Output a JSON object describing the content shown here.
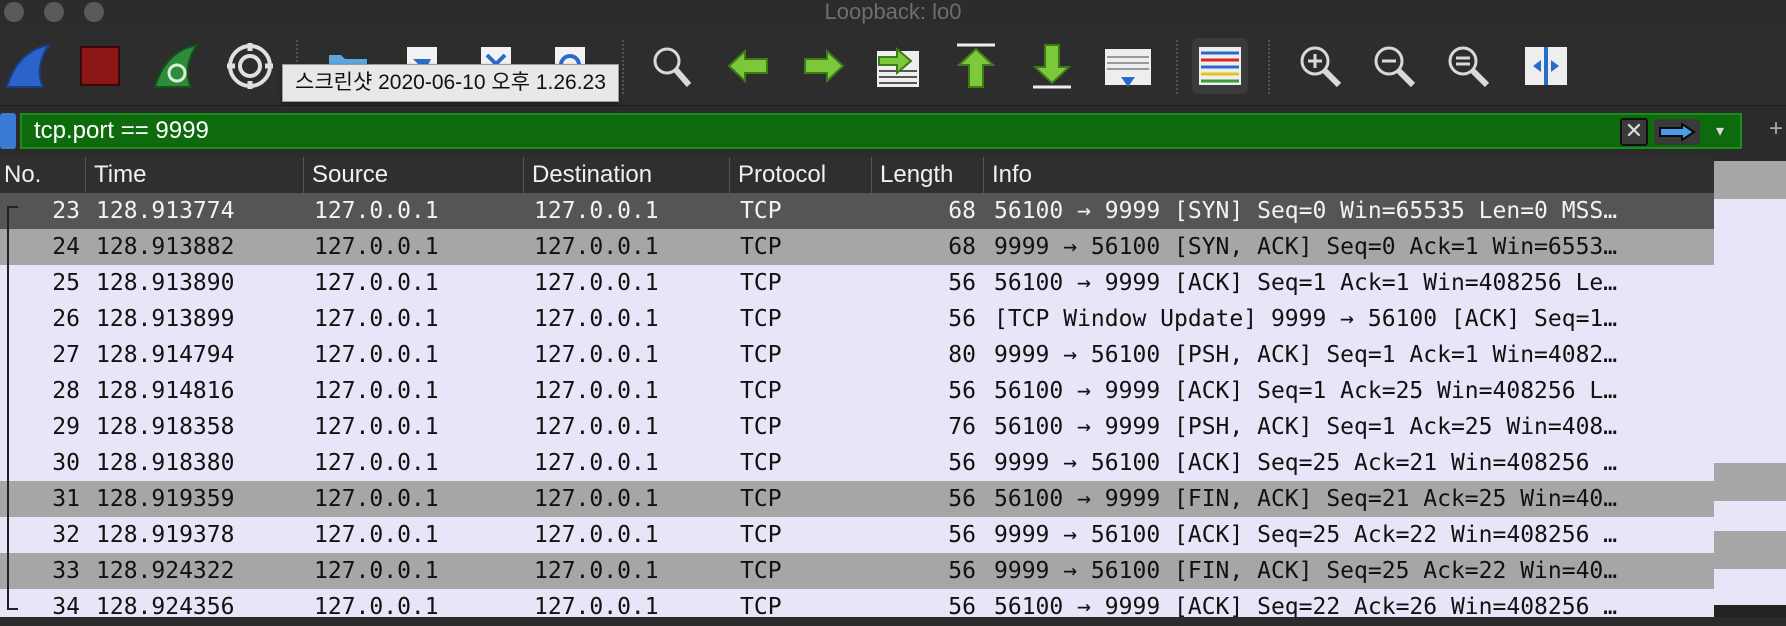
{
  "window": {
    "title": "Loopback: lo0"
  },
  "toolbar": {
    "buttons": [
      {
        "name": "start-capture-icon"
      },
      {
        "name": "stop-capture-icon"
      },
      {
        "name": "restart-capture-icon"
      },
      {
        "name": "capture-options-icon"
      },
      {
        "name": "open-file-icon"
      },
      {
        "name": "save-file-icon"
      },
      {
        "name": "close-file-icon"
      },
      {
        "name": "reload-file-icon"
      },
      {
        "name": "find-packet-icon"
      },
      {
        "name": "go-back-icon"
      },
      {
        "name": "go-forward-icon"
      },
      {
        "name": "go-to-packet-icon"
      },
      {
        "name": "go-to-first-packet-icon"
      },
      {
        "name": "go-to-last-packet-icon"
      },
      {
        "name": "auto-scroll-icon"
      },
      {
        "name": "colorize-icon"
      },
      {
        "name": "zoom-in-icon"
      },
      {
        "name": "zoom-out-icon"
      },
      {
        "name": "normal-size-icon"
      },
      {
        "name": "resize-columns-icon"
      }
    ],
    "tooltip": "스크린샷 2020-06-10 오후 1.26.23"
  },
  "filter": {
    "value": "tcp.port == 9999",
    "bg_color": "#0d6b0d"
  },
  "columns": [
    "No.",
    "Time",
    "Source",
    "Destination",
    "Protocol",
    "Length",
    "Info"
  ],
  "packets": [
    {
      "no": "23",
      "time": "128.913774",
      "source": "127.0.0.1",
      "destination": "127.0.0.1",
      "protocol": "TCP",
      "length": "68",
      "info": "56100 → 9999 [SYN] Seq=0 Win=65535 Len=0 MSS…",
      "style": "sel"
    },
    {
      "no": "24",
      "time": "128.913882",
      "source": "127.0.0.1",
      "destination": "127.0.0.1",
      "protocol": "TCP",
      "length": "68",
      "info": "9999 → 56100 [SYN, ACK] Seq=0 Ack=1 Win=6553…",
      "style": "grey"
    },
    {
      "no": "25",
      "time": "128.913890",
      "source": "127.0.0.1",
      "destination": "127.0.0.1",
      "protocol": "TCP",
      "length": "56",
      "info": "56100 → 9999 [ACK] Seq=1 Ack=1 Win=408256 Le…",
      "style": "light"
    },
    {
      "no": "26",
      "time": "128.913899",
      "source": "127.0.0.1",
      "destination": "127.0.0.1",
      "protocol": "TCP",
      "length": "56",
      "info": "[TCP Window Update] 9999 → 56100 [ACK] Seq=1…",
      "style": "light"
    },
    {
      "no": "27",
      "time": "128.914794",
      "source": "127.0.0.1",
      "destination": "127.0.0.1",
      "protocol": "TCP",
      "length": "80",
      "info": "9999 → 56100 [PSH, ACK] Seq=1 Ack=1 Win=4082…",
      "style": "light"
    },
    {
      "no": "28",
      "time": "128.914816",
      "source": "127.0.0.1",
      "destination": "127.0.0.1",
      "protocol": "TCP",
      "length": "56",
      "info": "56100 → 9999 [ACK] Seq=1 Ack=25 Win=408256 L…",
      "style": "light"
    },
    {
      "no": "29",
      "time": "128.918358",
      "source": "127.0.0.1",
      "destination": "127.0.0.1",
      "protocol": "TCP",
      "length": "76",
      "info": "56100 → 9999 [PSH, ACK] Seq=1 Ack=25 Win=408…",
      "style": "light"
    },
    {
      "no": "30",
      "time": "128.918380",
      "source": "127.0.0.1",
      "destination": "127.0.0.1",
      "protocol": "TCP",
      "length": "56",
      "info": "9999 → 56100 [ACK] Seq=25 Ack=21 Win=408256 …",
      "style": "light"
    },
    {
      "no": "31",
      "time": "128.919359",
      "source": "127.0.0.1",
      "destination": "127.0.0.1",
      "protocol": "TCP",
      "length": "56",
      "info": "56100 → 9999 [FIN, ACK] Seq=21 Ack=25 Win=40…",
      "style": "grey"
    },
    {
      "no": "32",
      "time": "128.919378",
      "source": "127.0.0.1",
      "destination": "127.0.0.1",
      "protocol": "TCP",
      "length": "56",
      "info": "9999 → 56100 [ACK] Seq=25 Ack=22 Win=408256 …",
      "style": "light"
    },
    {
      "no": "33",
      "time": "128.924322",
      "source": "127.0.0.1",
      "destination": "127.0.0.1",
      "protocol": "TCP",
      "length": "56",
      "info": "9999 → 56100 [FIN, ACK] Seq=25 Ack=22 Win=40…",
      "style": "grey"
    },
    {
      "no": "34",
      "time": "128.924356",
      "source": "127.0.0.1",
      "destination": "127.0.0.1",
      "protocol": "TCP",
      "length": "56",
      "info": "56100 → 9999 [ACK] Seq=22 Ack=26 Win=408256 …",
      "style": "light"
    }
  ],
  "colors": {
    "selected_row": "#555555",
    "grey_row": "#a6a6a6",
    "light_row": "#e6e6f8"
  }
}
